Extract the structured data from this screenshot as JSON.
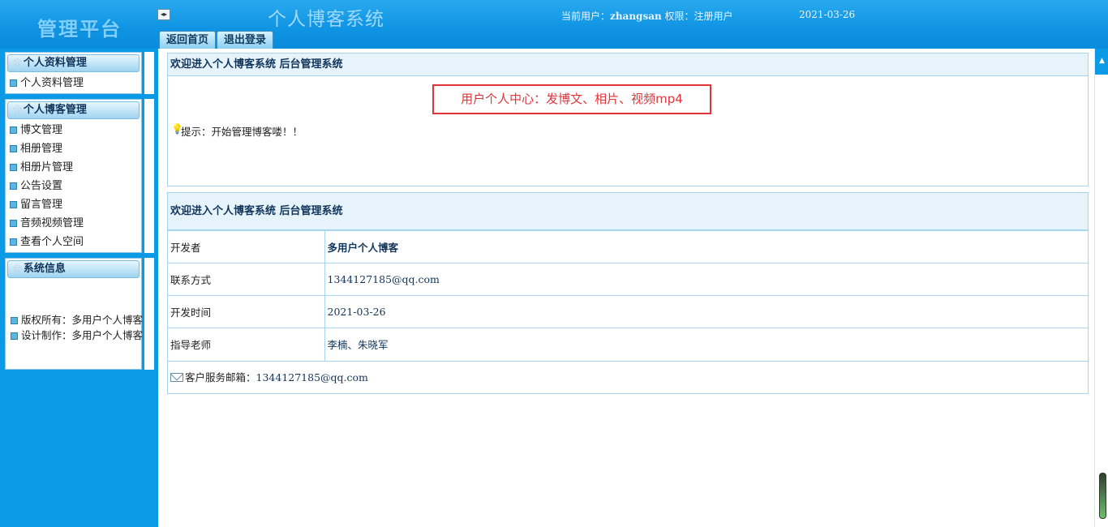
{
  "header": {
    "logo": "管理平台",
    "toggle_icon": "◂▸",
    "system_title": "个人博客系统",
    "user_prefix": "当前用户：",
    "username": "zhangsan",
    "role_prefix": " 权限：",
    "role": "注册用户",
    "date": "2021-03-26",
    "tabs": [
      {
        "label": "返回首页"
      },
      {
        "label": "退出登录"
      }
    ]
  },
  "sidebar": {
    "sections": [
      {
        "title": "个人资料管理",
        "items": [
          "个人资料管理"
        ]
      },
      {
        "title": "个人博客管理",
        "items": [
          "博文管理",
          "相册管理",
          "相册片管理",
          "公告设置",
          "留言管理",
          "音频视频管理",
          "查看个人空间"
        ]
      },
      {
        "title": "系统信息",
        "items": [
          "版权所有：多用户个人博客",
          "设计制作：多用户个人博客"
        ]
      }
    ]
  },
  "main": {
    "welcome_box": {
      "title": "欢迎进入个人博客系统 后台管理系统",
      "notice": "用户个人中心：发博文、相片、视频mp4",
      "hint": "提示：开始管理博客喽！！"
    },
    "info_box": {
      "title": "欢迎进入个人博客系统 后台管理系统",
      "rows": [
        {
          "label": "开发者",
          "value": "多用户个人博客"
        },
        {
          "label": "联系方式",
          "value": "1344127185@qq.com"
        },
        {
          "label": "开发时间",
          "value": "2021-03-26"
        },
        {
          "label": "指导老师",
          "value": "李楠、朱晓军"
        }
      ],
      "mail_label": "客户服务邮箱：",
      "mail_value": "1344127185@qq.com"
    }
  },
  "icons": {
    "star": "star-icon",
    "bullet": "square-bullet-icon",
    "bulb": "lightbulb-icon",
    "mail": "envelope-icon"
  },
  "colors": {
    "header_blue": "#0f94e3",
    "notice_red": "#e0343a"
  }
}
